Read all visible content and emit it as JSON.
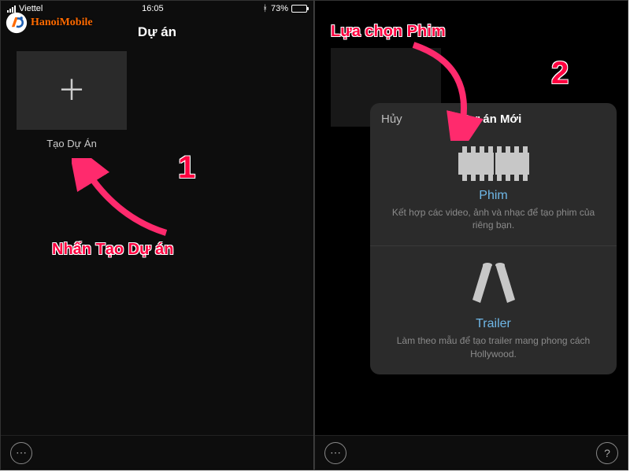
{
  "statusbar": {
    "carrier": "Viettel",
    "time": "16:05",
    "battery_pct": "73%"
  },
  "left": {
    "title": "Dự án",
    "create_label": "Tạo Dự Án"
  },
  "right": {
    "modal": {
      "cancel": "Hủy",
      "title": "Dự án Mới",
      "options": {
        "movie": {
          "title": "Phim",
          "desc": "Kết hợp các video, ảnh và nhạc để tạo phim của riêng bạn."
        },
        "trailer": {
          "title": "Trailer",
          "desc": "Làm theo mẫu để tạo trailer mang phong cách Hollywood."
        }
      }
    }
  },
  "annotations": {
    "step1_num": "1",
    "step1_text": "Nhấn Tạo Dự án",
    "step2_num": "2",
    "step2_text": "Lựa chọn Phim"
  },
  "watermark": {
    "text": "HanoiMobile"
  },
  "toolbar": {
    "more_glyph": "⋯",
    "help_glyph": "?"
  }
}
